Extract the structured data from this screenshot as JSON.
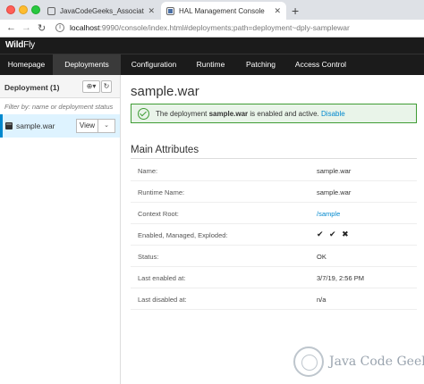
{
  "browser": {
    "tabs": [
      {
        "title": "JavaCodeGeeks_AssociateEdit",
        "close": "✕"
      },
      {
        "title": "HAL Management Console",
        "close": "✕"
      }
    ],
    "new_tab": "+",
    "url_host": "localhost",
    "url_rest": ":9990/console/index.html#deployments;path=deployment~dply-samplewar"
  },
  "app": {
    "logo_bold": "Wild",
    "logo_light": "Fly",
    "nav": [
      {
        "label": "Homepage"
      },
      {
        "label": "Deployments",
        "active": true
      },
      {
        "label": "Configuration"
      },
      {
        "label": "Runtime"
      },
      {
        "label": "Patching"
      },
      {
        "label": "Access Control"
      }
    ]
  },
  "sidebar": {
    "title": "Deployment (1)",
    "add_label": "⊕▾",
    "refresh_label": "↻",
    "filter_placeholder": "Filter by: name or deployment status",
    "items": [
      {
        "label": "sample.war",
        "view_label": "View",
        "caret": "⌄"
      }
    ]
  },
  "main": {
    "title": "sample.war",
    "alert": {
      "prefix": "The deployment ",
      "name": "sample.war",
      "suffix": " is enabled and active. ",
      "action": "Disable"
    },
    "section_title": "Main Attributes",
    "attributes": [
      {
        "label": "Name:",
        "value": "sample.war"
      },
      {
        "label": "Runtime Name:",
        "value": "sample.war"
      },
      {
        "label": "Context Root:",
        "value": "/sample"
      },
      {
        "label": "Enabled, Managed, Exploded:",
        "value": "✔ ✔ ✖"
      },
      {
        "label": "Status:",
        "value": "OK"
      },
      {
        "label": "Last enabled at:",
        "value": "3/7/19, 2:56 PM"
      },
      {
        "label": "Last disabled at:",
        "value": "n/a"
      }
    ]
  },
  "watermark": {
    "text": "Java Code Geeks"
  },
  "colors": {
    "accent": "#0088ce",
    "success": "#3f9c35",
    "header_bg": "#1b1b1b"
  }
}
